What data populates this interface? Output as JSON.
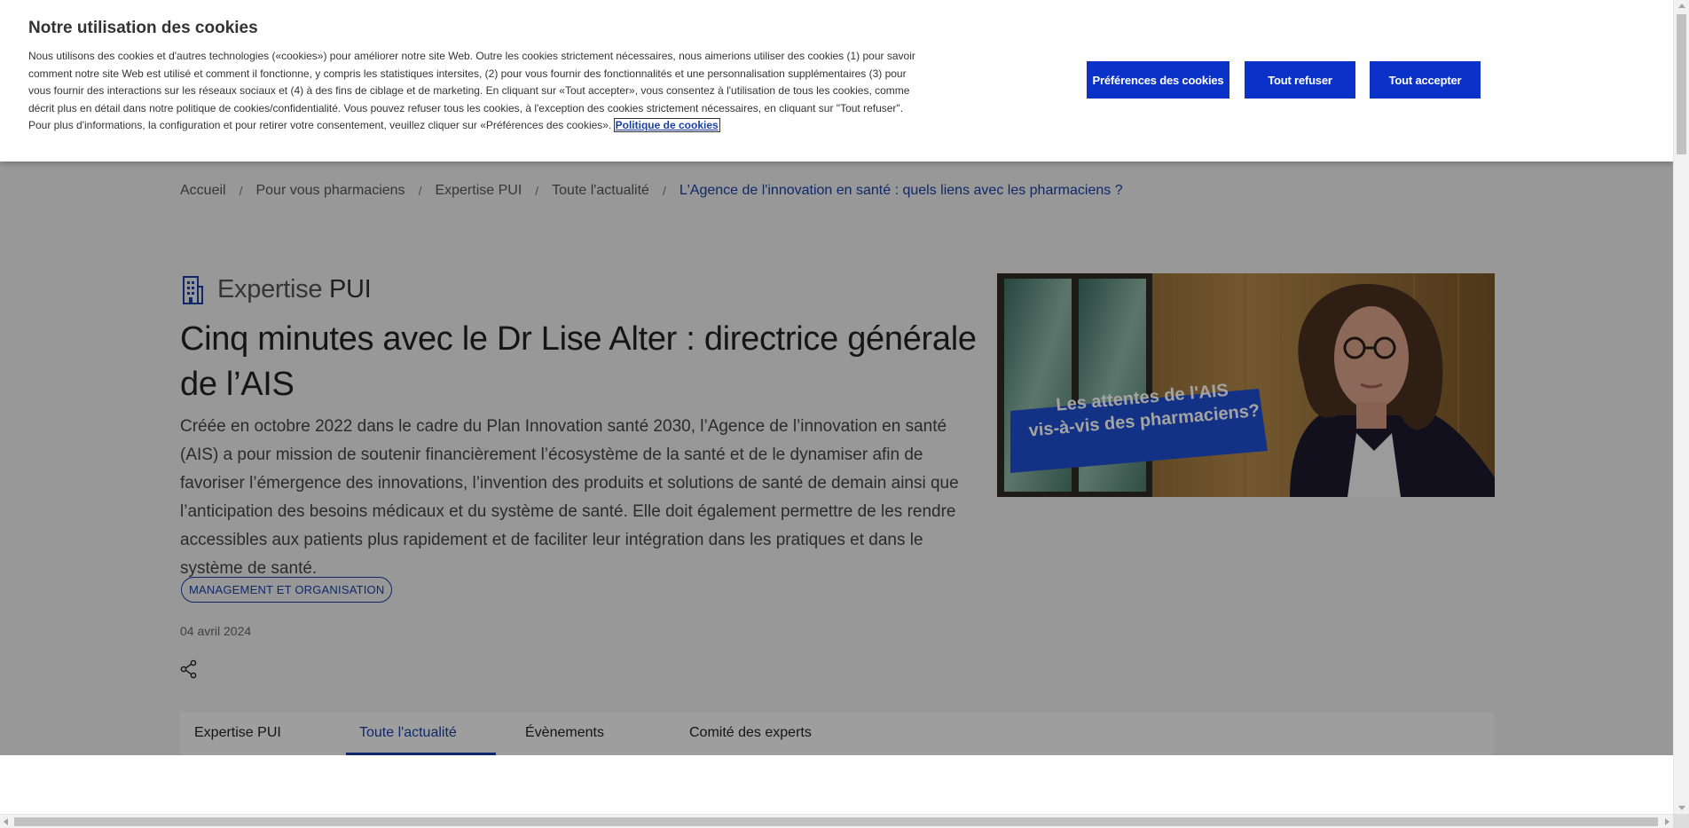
{
  "cookie_banner": {
    "title": "Notre utilisation des cookies",
    "text": "Nous utilisons des cookies et d'autres technologies («cookies») pour améliorer notre site Web. Outre les cookies strictement nécessaires, nous aimerions utiliser des cookies (1) pour savoir comment notre site Web est utilisé et comment il fonctionne, y compris les statistiques intersites, (2) pour vous fournir des fonctionnalités et une personnalisation supplémentaires (3) pour vous fournir des interactions sur les réseaux sociaux et (4) à des fins de ciblage et de marketing. En cliquant sur «Tout accepter», vous consentez à l'utilisation de tous les cookies, comme décrit plus en détail dans notre politique de cookies/confidentialité. Vous pouvez refuser tous les cookies, à l'exception des cookies strictement nécessaires, en cliquant sur \"Tout refuser\". Pour plus d'informations, la configuration et pour retirer votre consentement, veuillez cliquer sur «Préférences des cookies».",
    "policy_link": "Politique de cookies",
    "buttons": {
      "preferences": "Préférences des cookies",
      "reject_all": "Tout refuser",
      "accept_all": "Tout accepter"
    },
    "button_color": "#0a32c8"
  },
  "breadcrumb": [
    "Accueil",
    "Pour vous pharmaciens",
    "Expertise PUI",
    "Toute l'actualité",
    "L'Agence de l'innovation en santé : quels liens avec les pharmaciens ?"
  ],
  "breadcrumb_separator": "/",
  "section": {
    "icon": "building-icon",
    "title_light": "Expertise",
    "title_bold": "PUI"
  },
  "article": {
    "title": "Cinq minutes avec le Dr Lise Alter : directrice générale de l’AIS",
    "lead": "Créée en octobre 2022 dans le cadre du Plan Innovation santé 2030, l’Agence de l’innovation en santé (AIS) a pour mission de soutenir financièrement l’écosystème de la santé et de le dynamiser afin de favoriser l’émergence des innovations, l’invention des produits et solutions de santé de demain ainsi que l’anticipation des besoins médicaux et du système de santé. Elle doit également permettre de les rendre accessibles aux patients plus rapidement et de faciliter leur intégration dans les pratiques et dans le système de santé.",
    "tag": "MANAGEMENT ET ORGANISATION",
    "date": "04 avril 2024",
    "share_icon": "share-icon",
    "image_caption_line1": "Les attentes de l'AIS",
    "image_caption_line2": "vis-à-vis des pharmaciens?"
  },
  "tabs": [
    {
      "label": "Expertise PUI",
      "active": false
    },
    {
      "label": "Toute l'actualité",
      "active": true
    },
    {
      "label": "Évènements",
      "active": false
    },
    {
      "label": "Comité des experts",
      "active": false
    }
  ],
  "colors": {
    "accent": "#1a3fa6",
    "overlay": "rgba(0,0,0,0.36)"
  }
}
